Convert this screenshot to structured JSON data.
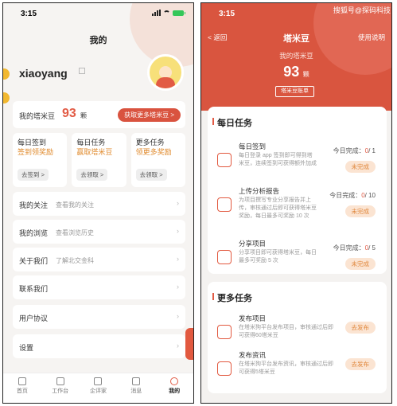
{
  "status": {
    "time": "3:15"
  },
  "left": {
    "title": "我的",
    "username": "xiaoyang",
    "coins": {
      "label": "我的塔米豆",
      "value": "93",
      "unit": "颗",
      "button": "获取更多塔米豆 >"
    },
    "tasks": [
      {
        "title": "每日签到",
        "subtitle": "签到领奖励",
        "button": "去签到 >"
      },
      {
        "title": "每日任务",
        "subtitle": "赢取塔米豆",
        "button": "去领取 >"
      },
      {
        "title": "更多任务",
        "subtitle": "领更多奖励",
        "button": "去领取 >"
      }
    ],
    "menu": [
      {
        "label": "我的关注",
        "sub": "查看我的关注"
      },
      {
        "label": "我的浏览",
        "sub": "查看浏览历史"
      },
      {
        "label": "关于我们",
        "sub": "了解北交金科"
      },
      {
        "label": "联系我们",
        "sub": ""
      },
      {
        "label": "用户协议",
        "sub": ""
      },
      {
        "label": "设置",
        "sub": ""
      }
    ],
    "tabs": [
      {
        "label": "首页",
        "icon": "home-icon"
      },
      {
        "label": "工作台",
        "icon": "star-icon"
      },
      {
        "label": "企评家",
        "icon": "shield-icon"
      },
      {
        "label": "消息",
        "icon": "message-icon"
      },
      {
        "label": "我的",
        "icon": "user-icon"
      }
    ]
  },
  "right": {
    "back": "< 返回",
    "title": "塔米豆",
    "help": "使用说明",
    "subtitle": "我的塔米豆",
    "value": "93",
    "unit": "颗",
    "account_button": "塔米豆账单",
    "daily_title": "每日任务",
    "daily_tasks": [
      {
        "name": "每日签到",
        "desc": "每日登录 app 签到即可得到塔米豆，连续签到可获得额外加成",
        "prog_label": "今日完成：",
        "done": "0",
        "total": "/ 1",
        "button": "未完成"
      },
      {
        "name": "上传分析报告",
        "desc": "为项目撰写专业分享报告并上传，审核通过后即可获得塔米豆奖励，每日最多可奖励 10 次",
        "prog_label": "今日完成：",
        "done": "0",
        "total": "/ 10",
        "button": "未完成"
      },
      {
        "name": "分享项目",
        "desc": "分享项目即可获得塔米豆，每日最多可奖励 5 次",
        "prog_label": "今日完成：",
        "done": "0",
        "total": "/ 5",
        "button": "未完成"
      }
    ],
    "more_title": "更多任务",
    "more_tasks": [
      {
        "name": "发布项目",
        "desc": "在塔米狗平台发布项目，审核通过后即可获得60塔米豆",
        "button": "去发布"
      },
      {
        "name": "发布资讯",
        "desc": "在塔米狗平台发布资讯，审核通过后即可获得5塔米豆",
        "button": "去发布"
      }
    ]
  },
  "watermark": "搜狐号@探码科技"
}
